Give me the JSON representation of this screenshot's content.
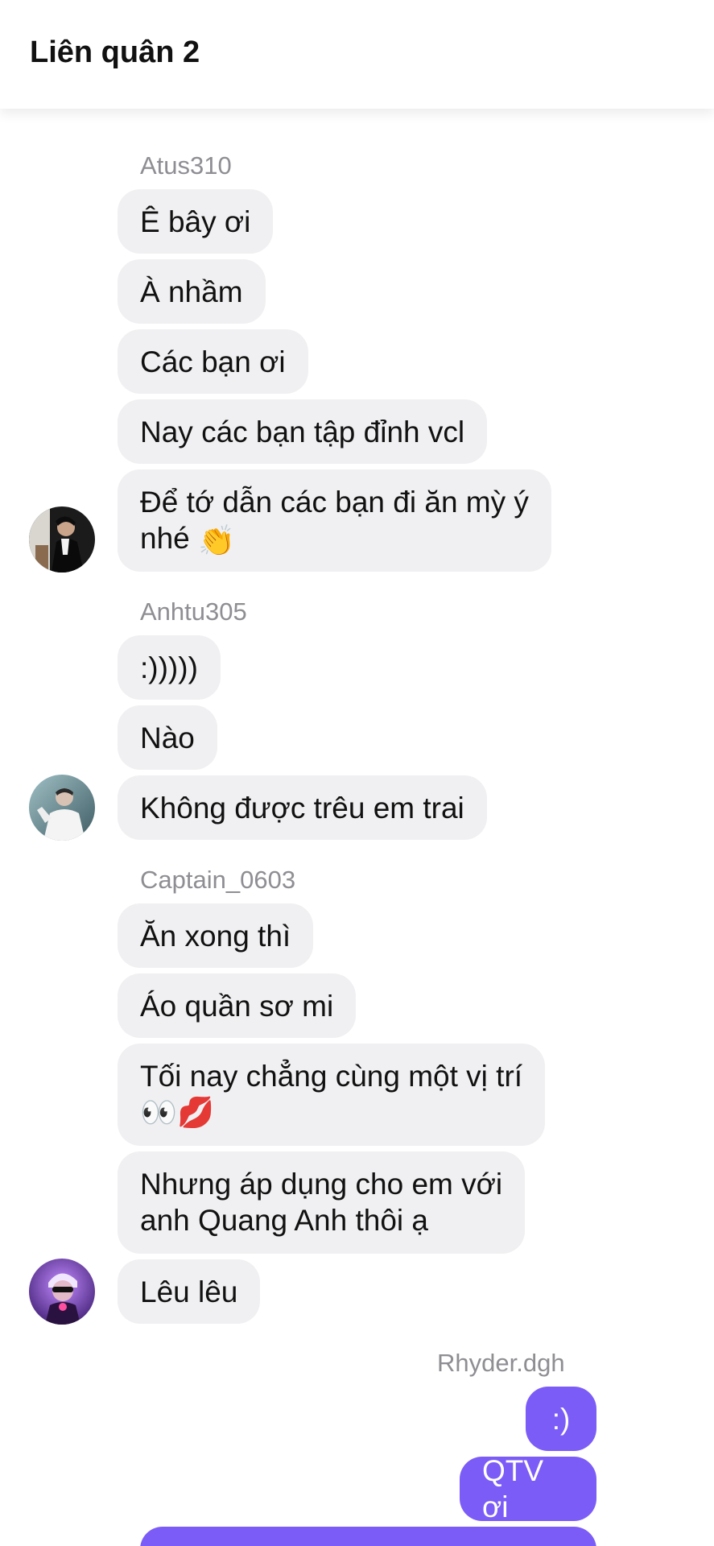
{
  "header": {
    "title": "Liên quân 2"
  },
  "groups": [
    {
      "sender": "Atus310",
      "messages": [
        "Ê bây ơi",
        "À nhầm",
        "Các bạn ơi",
        "Nay các bạn tập đỉnh vcl",
        {
          "line1": "Để tớ dẫn các bạn đi ăn mỳ ý",
          "line2": "nhé",
          "emoji": "👏"
        }
      ]
    },
    {
      "sender": "Anhtu305",
      "messages": [
        ":)))))",
        "Nào",
        "Không được trêu em trai"
      ]
    },
    {
      "sender": "Captain_0603",
      "messages": [
        "Ăn xong thì",
        "Áo quần sơ mi",
        {
          "line1": "Tối nay chẳng cùng một vị trí",
          "emoji": "👀💋"
        },
        {
          "line1": "Nhưng áp dụng cho em với",
          "line2": "anh Quang Anh thôi ạ"
        },
        "Lêu lêu"
      ]
    },
    {
      "sender": "Rhyder.dgh",
      "messages": [
        ":)",
        "QTV ơi"
      ]
    }
  ],
  "colors": {
    "incoming_bubble": "#f0f0f2",
    "outgoing_bubble": "#7b5cf7",
    "sender_name": "#8e8e93"
  },
  "icons": {
    "avatar_1": "avatar-atus310",
    "avatar_2": "avatar-anhtu305",
    "avatar_3": "avatar-captain0603"
  }
}
